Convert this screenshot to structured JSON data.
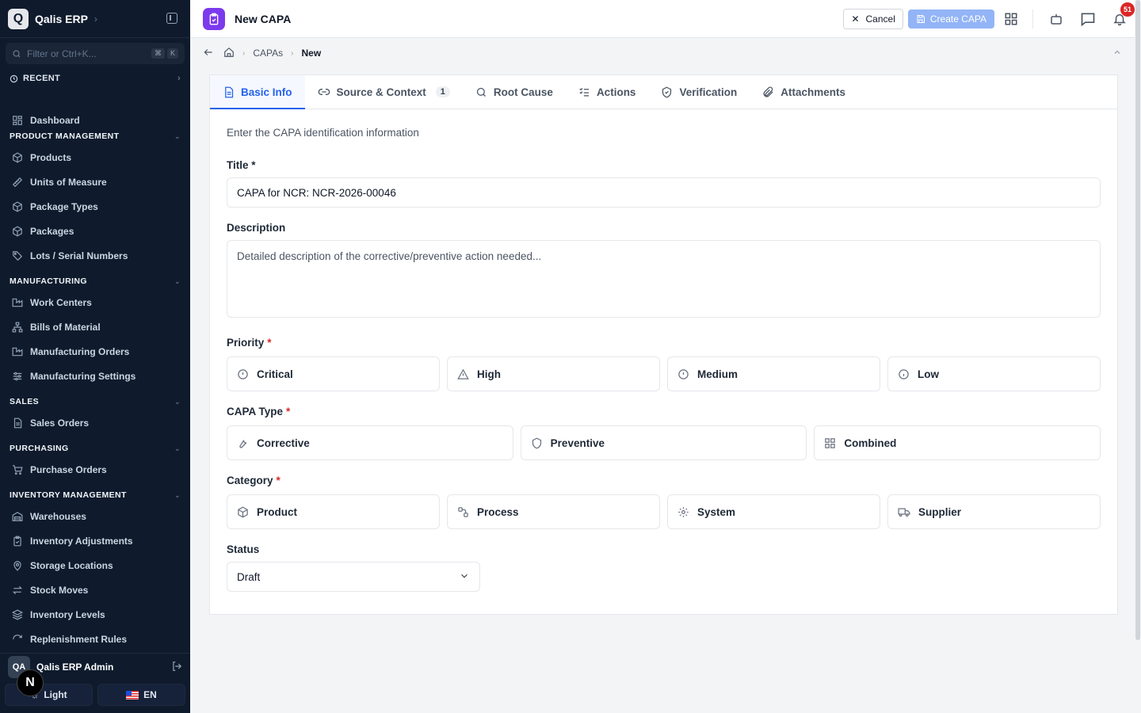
{
  "sidebar": {
    "brand_letter": "Q",
    "brand_name": "Qalis ERP",
    "filter_placeholder": "Filter or Ctrl+K...",
    "filter_kbd_1": "⌘",
    "filter_kbd_2": "K",
    "recent_label": "RECENT",
    "dashboard": "Dashboard",
    "sections": {
      "product_management": {
        "title": "PRODUCT MANAGEMENT",
        "items": [
          "Products",
          "Units of Measure",
          "Package Types",
          "Packages",
          "Lots / Serial Numbers"
        ]
      },
      "manufacturing": {
        "title": "MANUFACTURING",
        "items": [
          "Work Centers",
          "Bills of Material",
          "Manufacturing Orders",
          "Manufacturing Settings"
        ]
      },
      "sales": {
        "title": "SALES",
        "items": [
          "Sales Orders"
        ]
      },
      "purchasing": {
        "title": "PURCHASING",
        "items": [
          "Purchase Orders"
        ]
      },
      "inventory": {
        "title": "INVENTORY MANAGEMENT",
        "items": [
          "Warehouses",
          "Inventory Adjustments",
          "Storage Locations",
          "Stock Moves",
          "Inventory Levels",
          "Replenishment Rules"
        ]
      }
    },
    "user_initials": "QA",
    "user_name": "Qalis ERP Admin",
    "theme_label": "Light",
    "lang_label": "EN",
    "n_badge": "N"
  },
  "header": {
    "title": "New CAPA",
    "cancel_label": "Cancel",
    "create_label": "Create CAPA",
    "notif_count": "51"
  },
  "breadcrumb": {
    "level1": "CAPAs",
    "level2": "New"
  },
  "tabs": [
    {
      "label": "Basic Info",
      "icon": "file-icon"
    },
    {
      "label": "Source & Context",
      "icon": "link-icon",
      "count": "1"
    },
    {
      "label": "Root Cause",
      "icon": "search-icon"
    },
    {
      "label": "Actions",
      "icon": "list-check-icon"
    },
    {
      "label": "Verification",
      "icon": "shield-check-icon"
    },
    {
      "label": "Attachments",
      "icon": "paperclip-icon"
    }
  ],
  "form": {
    "intro": "Enter the CAPA identification information",
    "title_label": "Title *",
    "title_value": "CAPA for NCR: NCR-2026-00046",
    "description_label": "Description",
    "description_placeholder": "Detailed description of the corrective/preventive action needed...",
    "priority_label": "Priority",
    "priority_options": [
      "Critical",
      "High",
      "Medium",
      "Low"
    ],
    "type_label": "CAPA Type",
    "type_options": [
      "Corrective",
      "Preventive",
      "Combined"
    ],
    "category_label": "Category",
    "category_options": [
      "Product",
      "Process",
      "System",
      "Supplier"
    ],
    "status_label": "Status",
    "status_value": "Draft",
    "required_mark": "*"
  },
  "colors": {
    "sidebar_bg": "#0f1b2d",
    "accent": "#2563eb",
    "page_icon": "#7c3aed",
    "create_btn": "#93b4f6",
    "required": "#dc2626"
  }
}
